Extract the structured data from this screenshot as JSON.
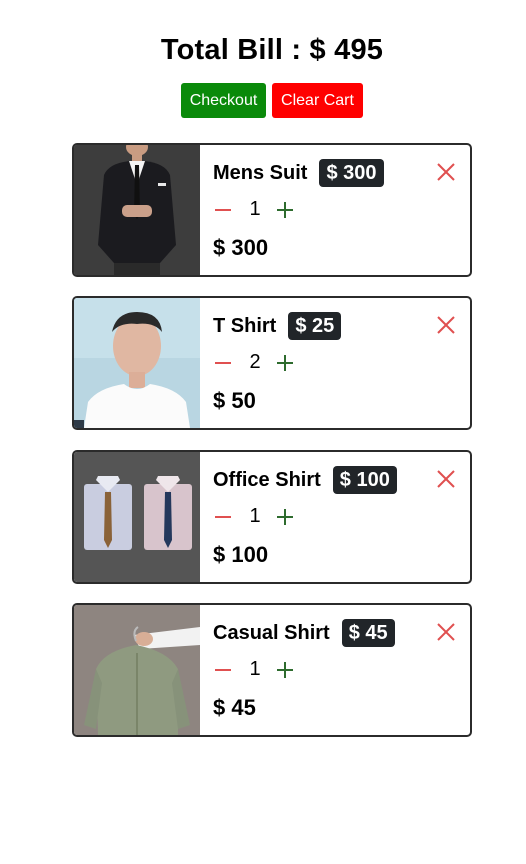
{
  "cart": {
    "total_label": "Total Bill : $ 495",
    "checkout_label": "Checkout",
    "clear_label": "Clear Cart",
    "colors": {
      "checkout": "#0a8a0a",
      "clear": "#ff0000",
      "badge": "#212529",
      "remove_icon": "#e05050",
      "minus_icon": "#e05050",
      "plus_icon": "#2e6b2e"
    },
    "items": [
      {
        "name": "Mens Suit",
        "price": "$ 300",
        "quantity": "1",
        "subtotal": "$ 300",
        "image": "mens-suit-photo"
      },
      {
        "name": "T Shirt",
        "price": "$ 25",
        "quantity": "2",
        "subtotal": "$ 50",
        "image": "t-shirt-photo"
      },
      {
        "name": "Office Shirt",
        "price": "$ 100",
        "quantity": "1",
        "subtotal": "$ 100",
        "image": "office-shirt-photo"
      },
      {
        "name": "Casual Shirt",
        "price": "$ 45",
        "quantity": "1",
        "subtotal": "$ 45",
        "image": "casual-shirt-photo"
      }
    ]
  }
}
